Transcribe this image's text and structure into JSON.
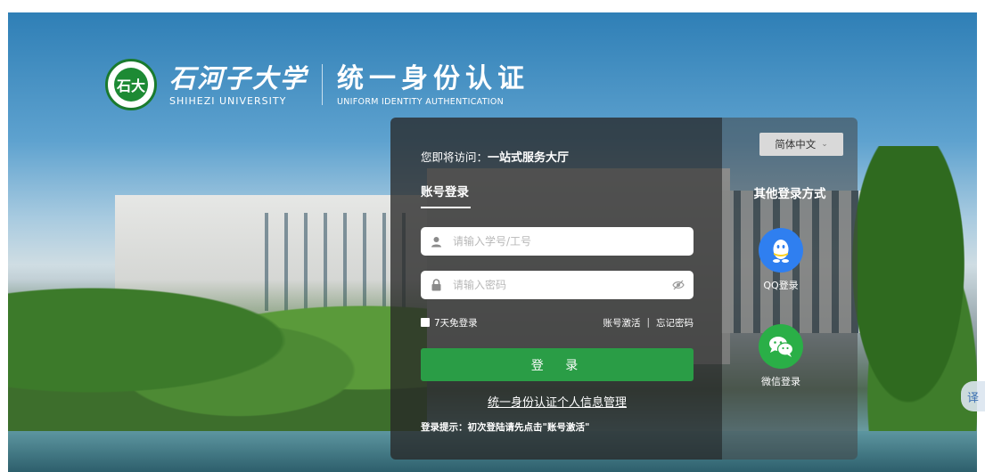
{
  "brand": {
    "seal_text": "石大",
    "school_cn": "石河子大学",
    "school_en": "SHIHEZI UNIVERSITY",
    "system_cn": "统一身份认证",
    "system_en": "UNIFORM IDENTITY AUTHENTICATION"
  },
  "login": {
    "visit_prefix": "您即将访问：",
    "visit_target": "一站式服务大厅",
    "tab_account": "账号登录",
    "username_placeholder": "请输入学号/工号",
    "password_placeholder": "请输入密码",
    "remember_label": "7天免登录",
    "activate_link": "账号激活",
    "separator": "|",
    "forgot_link": "忘记密码",
    "login_button": "登 录",
    "manage_link": "统一身份认证个人信息管理",
    "tip": "登录提示：初次登陆请先点击\"账号激活\""
  },
  "other": {
    "language": "简体中文",
    "title": "其他登录方式",
    "qq_label": "QQ登录",
    "wechat_label": "微信登录"
  },
  "float_tab": {
    "label": "译"
  },
  "colors": {
    "login_green": "#2a9d46",
    "qq_blue": "#2f7ff0",
    "wechat_green": "#2aaf47"
  }
}
